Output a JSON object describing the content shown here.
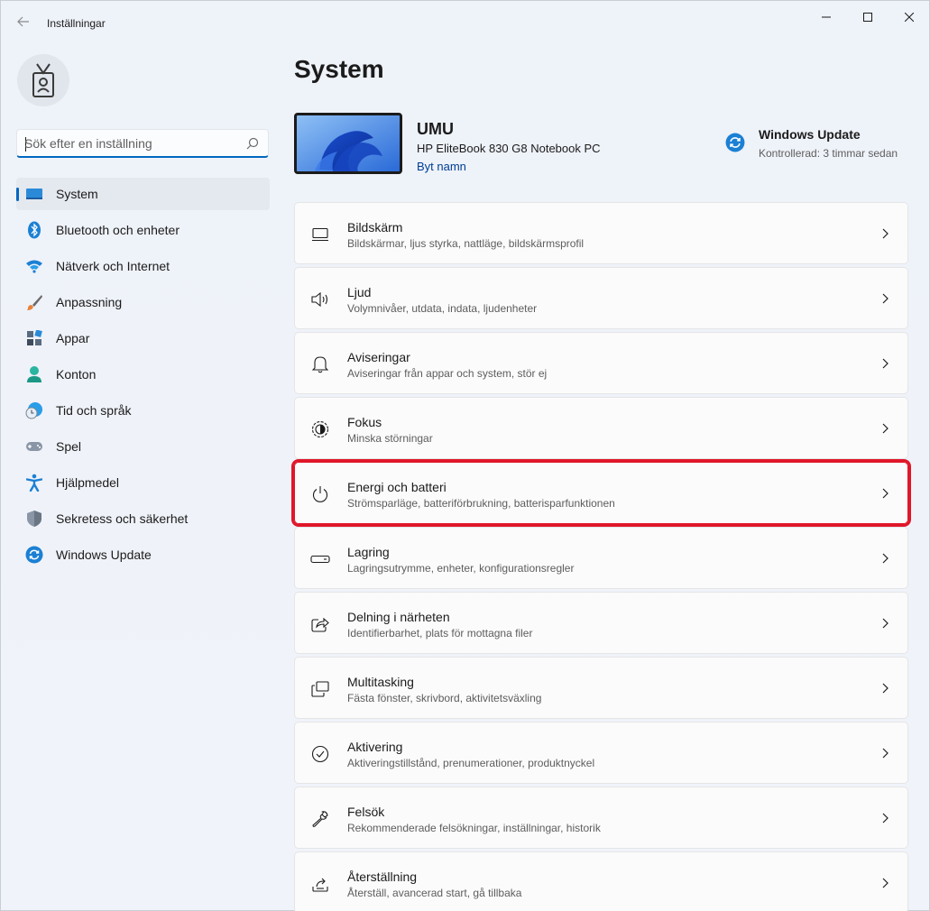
{
  "window": {
    "title": "Inställningar"
  },
  "search": {
    "placeholder": "Sök efter en inställning",
    "value": ""
  },
  "sidebar": {
    "items": [
      {
        "label": "System",
        "icon": "monitor-icon",
        "active": true
      },
      {
        "label": "Bluetooth och enheter",
        "icon": "bluetooth-icon"
      },
      {
        "label": "Nätverk och Internet",
        "icon": "wifi-icon"
      },
      {
        "label": "Anpassning",
        "icon": "brush-icon"
      },
      {
        "label": "Appar",
        "icon": "apps-icon"
      },
      {
        "label": "Konton",
        "icon": "person-icon"
      },
      {
        "label": "Tid och språk",
        "icon": "globe-clock-icon"
      },
      {
        "label": "Spel",
        "icon": "gamepad-icon"
      },
      {
        "label": "Hjälpmedel",
        "icon": "accessibility-icon"
      },
      {
        "label": "Sekretess och säkerhet",
        "icon": "shield-icon"
      },
      {
        "label": "Windows Update",
        "icon": "update-icon"
      }
    ]
  },
  "main": {
    "title": "System",
    "device": {
      "name": "UMU",
      "model": "HP EliteBook 830 G8 Notebook PC",
      "rename_label": "Byt namn"
    },
    "update": {
      "title": "Windows Update",
      "status": "Kontrollerad: 3 timmar sedan"
    },
    "cards": [
      {
        "title": "Bildskärm",
        "subtitle": "Bildskärmar, ljus styrka, nattläge, bildskärmsprofil",
        "icon": "display-icon"
      },
      {
        "title": "Ljud",
        "subtitle": "Volymnivåer, utdata, indata, ljudenheter",
        "icon": "speaker-icon"
      },
      {
        "title": "Aviseringar",
        "subtitle": "Aviseringar från appar och system, stör ej",
        "icon": "bell-icon"
      },
      {
        "title": "Fokus",
        "subtitle": "Minska störningar",
        "icon": "focus-icon"
      },
      {
        "title": "Energi och batteri",
        "subtitle": "Strömsparläge, batteriförbrukning, batterisparfunktionen",
        "icon": "power-icon",
        "highlighted": true
      },
      {
        "title": "Lagring",
        "subtitle": "Lagringsutrymme, enheter, konfigurationsregler",
        "icon": "storage-icon"
      },
      {
        "title": "Delning i närheten",
        "subtitle": "Identifierbarhet, plats för mottagna filer",
        "icon": "share-icon"
      },
      {
        "title": "Multitasking",
        "subtitle": "Fästa fönster, skrivbord, aktivitetsväxling",
        "icon": "multitask-icon"
      },
      {
        "title": "Aktivering",
        "subtitle": "Aktiveringstillstånd, prenumerationer, produktnyckel",
        "icon": "check-circle-icon"
      },
      {
        "title": "Felsök",
        "subtitle": "Rekommenderade felsökningar, inställningar, historik",
        "icon": "wrench-icon"
      },
      {
        "title": "Återställning",
        "subtitle": "Återställ, avancerad start, gå tillbaka",
        "icon": "recovery-icon"
      }
    ]
  },
  "colors": {
    "accent": "#0067c0",
    "highlight": "#e0172a",
    "link": "#003e92"
  }
}
